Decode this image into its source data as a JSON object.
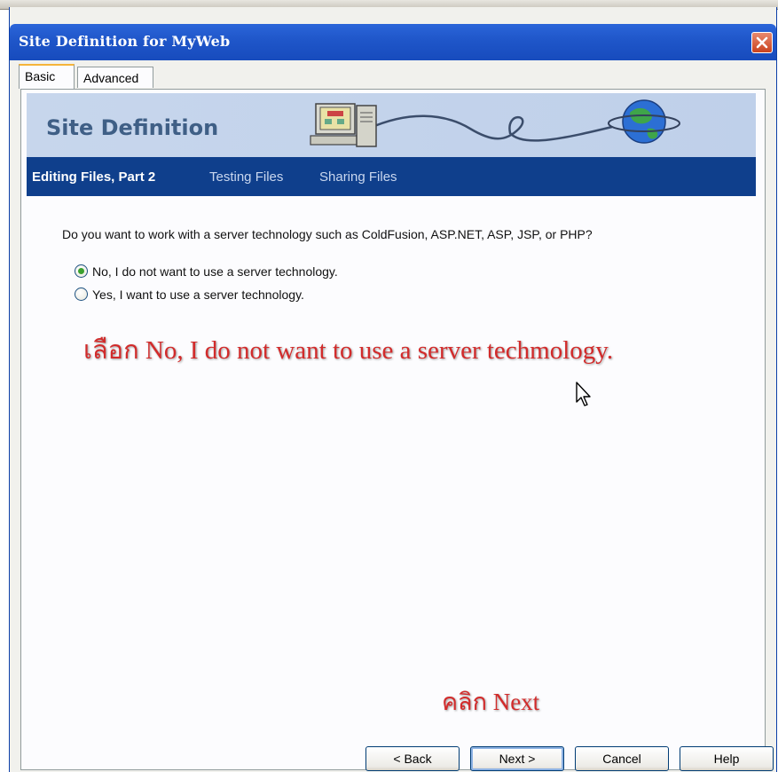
{
  "window": {
    "title": "Site Definition for MyWeb"
  },
  "tabs": [
    {
      "label": "Basic",
      "active": true
    },
    {
      "label": "Advanced",
      "active": false
    }
  ],
  "banner": {
    "heading": "Site Definition"
  },
  "steps": [
    {
      "label": "Editing Files, Part 2",
      "current": true
    },
    {
      "label": "Testing Files",
      "current": false
    },
    {
      "label": "Sharing Files",
      "current": false
    }
  ],
  "question": "Do you want to work with a server technology such as ColdFusion, ASP.NET, ASP, JSP, or PHP?",
  "options": [
    {
      "label": "No, I do not want to use a server technology.",
      "selected": true
    },
    {
      "label": "Yes, I want to use a server technology.",
      "selected": false
    }
  ],
  "annotations": {
    "select_note": "เลือก No, I do not want to use a server techmology.",
    "click_note": "คลิก Next"
  },
  "buttons": {
    "back": "< Back",
    "next": "Next >",
    "cancel": "Cancel",
    "help": "Help"
  },
  "colors": {
    "titlebar": "#1f56c9",
    "steps_bar": "#0f3f8c",
    "annotation": "#d22b2b"
  }
}
